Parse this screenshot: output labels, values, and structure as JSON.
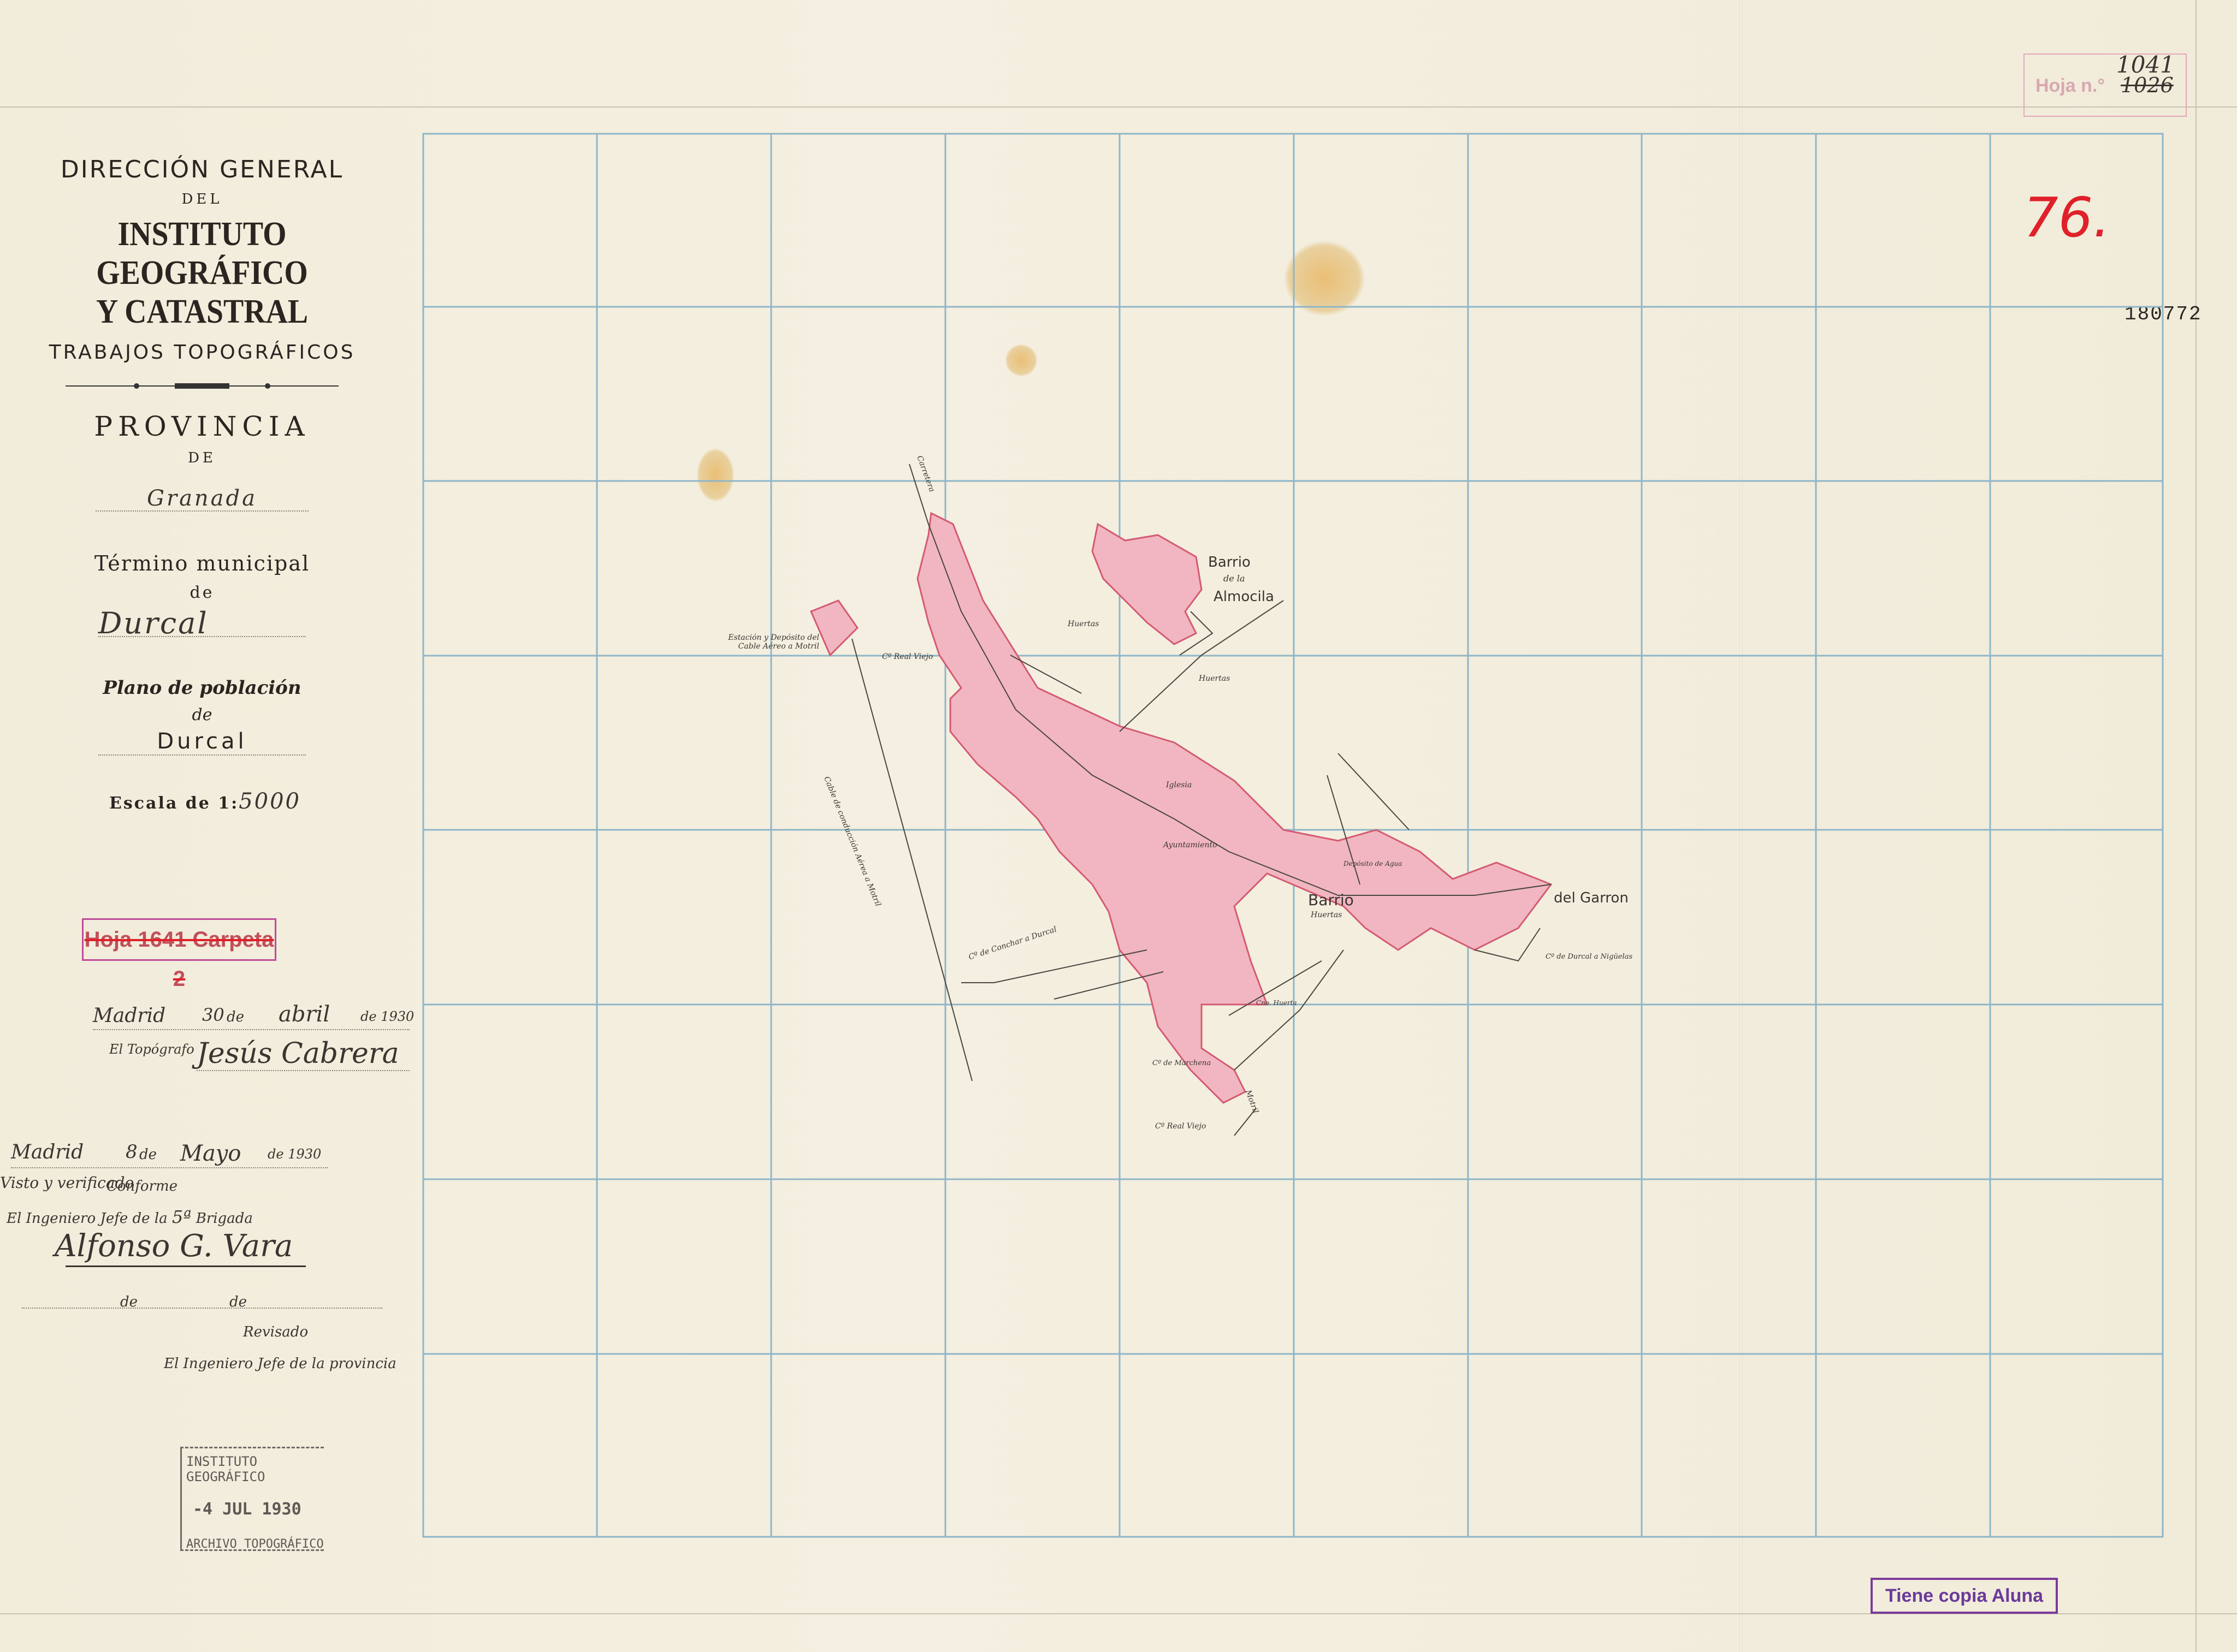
{
  "title_block": {
    "line1": "DIRECCIÓN GENERAL",
    "line2": "DEL",
    "line3": "INSTITUTO GEOGRÁFICO",
    "line4": "Y CATASTRAL",
    "line5": "TRABAJOS TOPOGRÁFICOS",
    "provincia_label": "PROVINCIA",
    "de1": "DE",
    "provincia_value": "Granada",
    "termino_label": "Término municipal",
    "de2": "de",
    "termino_value": "Durcal",
    "plano_label": "Plano de población",
    "de3": "de",
    "plano_value": "Durcal",
    "escala_label": "Escala de 1:",
    "escala_value": "5000"
  },
  "stamp_hoja_carpeta": "Hoja 1641 Carpeta 2",
  "signatures": {
    "madrid1": "Madrid",
    "day1": "30",
    "de_a": "de",
    "month1": "abril",
    "year_prefix1": "de 19",
    "year1": "30",
    "topografo_label": "El Topógrafo",
    "topografo_sig": "Jesús Cabrera",
    "madrid2": "Madrid",
    "day2": "8",
    "de_b": "de",
    "month2": "Mayo",
    "year_prefix2": "de 19",
    "year2": "30",
    "conforme_note": "Visto y verificado",
    "conforme": "Conforme",
    "ingeniero_brigada": "El Ingeniero Jefe de la",
    "brigada_num": "5ª",
    "brigada_label": "Brigada",
    "ingeniero_sig": "Alfonso G. Vara",
    "de_c": "de",
    "de_d": "de",
    "revisado": "Revisado",
    "ingeniero_provincia": "El Ingeniero Jefe de la provincia"
  },
  "archive_stamp": {
    "line1": "INSTITUTO GEOGRÁFICO",
    "line2": "-4 JUL 1930",
    "line3": "ARCHIVO TOPOGRÁFICO"
  },
  "top_right_stamp": {
    "label": "Hoja n.°",
    "value": "1041",
    "struck": "1026"
  },
  "red_number": "76.",
  "sheet_number": "180772",
  "copy_stamp": "Tiene copia Aluna",
  "map_labels": {
    "barrio_almocila_1": "Barrio",
    "barrio_almocila_2": "de la",
    "barrio_almocila_3": "Almocila",
    "barrio_garron_1": "Barrio",
    "barrio_garron_2": "del Garron",
    "iglesia": "Iglesia",
    "ayuntamiento": "Ayuntamiento",
    "huertas1": "Huertas",
    "huertas2": "Huertas",
    "huertas3": "Huertas",
    "estacion": "Estación y Depósito del Cable Aéreo a Motril",
    "carretera": "Carretera",
    "camino_real": "Cº Real Viejo",
    "camino_real2": "Cº Real Viejo",
    "cable": "Cable de conducción Aérea a Motril",
    "deposito": "Depósito de Agua",
    "cno_durcal_niguelas": "Cº de Durcal a Nigüelas",
    "cno_conchar": "Cº de Conchar a Durcal",
    "cno_marchena": "Cº de Marchena",
    "cno_huerta": "Cno. Huerta",
    "motril": "Motril"
  },
  "colors": {
    "grid": "#8fb6c8",
    "settlement": "#e8899a",
    "settlement_fill": "#f1b6c1",
    "red_ink": "#e0202a",
    "stamp_purple": "#6a3a9a"
  }
}
